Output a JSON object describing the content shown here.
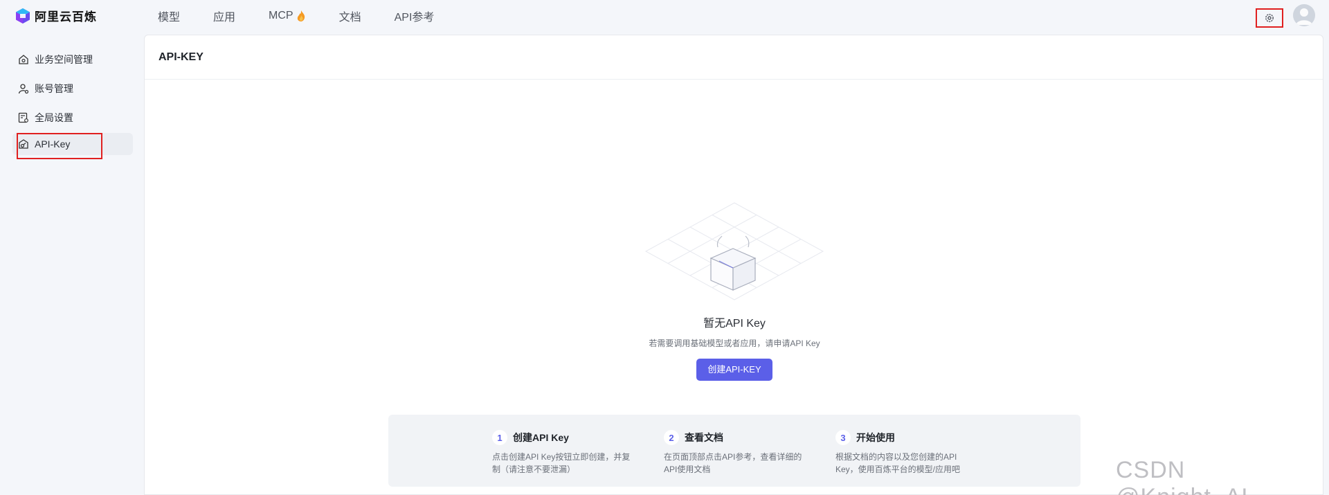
{
  "app": {
    "name": "阿里云百炼"
  },
  "nav": {
    "items": [
      "模型",
      "应用",
      "MCP",
      "文档",
      "API参考"
    ]
  },
  "sidebar": {
    "items": [
      {
        "label": "业务空间管理",
        "icon": "home-icon"
      },
      {
        "label": "账号管理",
        "icon": "user-settings-icon"
      },
      {
        "label": "全局设置",
        "icon": "settings-doc-icon"
      },
      {
        "label": "API-Key",
        "icon": "key-icon",
        "active": true
      }
    ]
  },
  "panel": {
    "title": "API-KEY",
    "empty": {
      "title": "暂无API Key",
      "desc": "若需要调用基础模型或者应用，请申请API Key",
      "button": "创建API-KEY"
    },
    "steps": [
      {
        "num": "1",
        "title": "创建API Key",
        "desc": "点击创建API Key按钮立即创建，并复制（请注意不要泄漏）"
      },
      {
        "num": "2",
        "title": "查看文档",
        "desc": "在页面顶部点击API参考，查看详细的API使用文档"
      },
      {
        "num": "3",
        "title": "开始使用",
        "desc": "根据文档的内容以及您创建的API Key，使用百炼平台的模型/应用吧"
      }
    ]
  },
  "watermark": "CSDN @Knight_AL",
  "colors": {
    "accent": "#5b5fe8",
    "highlight": "#e02020"
  }
}
